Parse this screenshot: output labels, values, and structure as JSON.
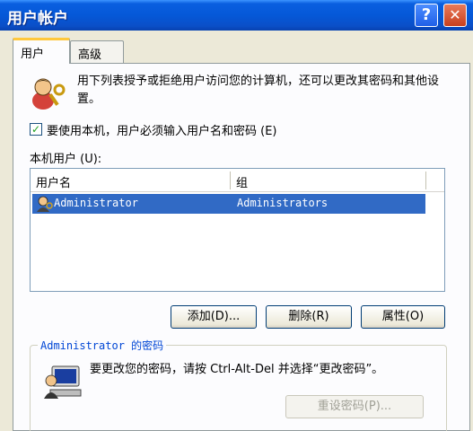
{
  "window": {
    "title": "用户帐户",
    "help_glyph": "?",
    "close_glyph": "✕"
  },
  "tabs": [
    {
      "label": "用户",
      "active": true
    },
    {
      "label": "高级",
      "active": false
    }
  ],
  "intro": {
    "text": "用下列表授予或拒绝用户访问您的计算机，还可以更改其密码和其他设置。"
  },
  "require_login": {
    "checked": true,
    "label": "要使用本机，用户必须输入用户名和密码 (E)"
  },
  "local_users": {
    "label": "本机用户 (U):",
    "columns": [
      "用户名",
      "组"
    ],
    "rows": [
      {
        "name": "Administrator",
        "group": "Administrators",
        "selected": true
      }
    ]
  },
  "buttons": {
    "add": "添加(D)...",
    "remove": "删除(R)",
    "properties": "属性(O)"
  },
  "password_group": {
    "legend": "Administrator 的密码",
    "text": "要更改您的密码，请按 Ctrl-Alt-Del 并选择“更改密码”。",
    "reset_button": "重设密码(P)..."
  },
  "colors": {
    "titlebar": "#0558d8",
    "selection": "#316ac5",
    "dialog_bg": "#ece9d8"
  }
}
